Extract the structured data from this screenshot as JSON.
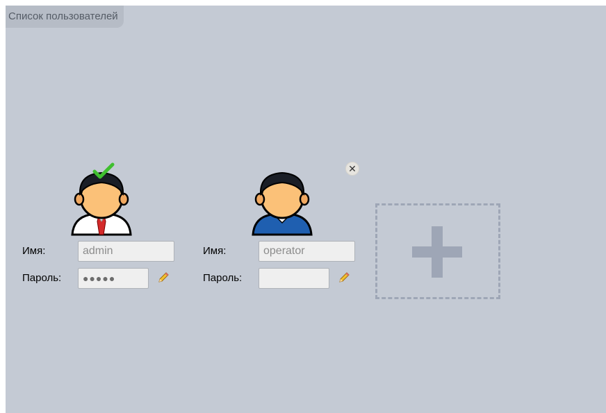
{
  "panel": {
    "title": "Список пользователей"
  },
  "users": [
    {
      "name_label": "Имя:",
      "name_value": "admin",
      "password_label": "Пароль:",
      "password_mask": "●●●●●",
      "is_current": true,
      "avatar_icon": "admin-user-avatar-icon"
    },
    {
      "name_label": "Имя:",
      "name_value": "operator",
      "password_label": "Пароль:",
      "password_mask": "",
      "is_current": false,
      "avatar_icon": "operator-user-avatar-icon"
    }
  ],
  "icons": {
    "edit": "pencil-icon",
    "remove": "close-icon",
    "add": "plus-icon",
    "selected": "checkmark-icon"
  },
  "remove_glyph": "✕",
  "colors": {
    "panel_bg": "#c4cad4",
    "add_box_border": "#9ea6b6",
    "field_bg": "#efefef"
  }
}
